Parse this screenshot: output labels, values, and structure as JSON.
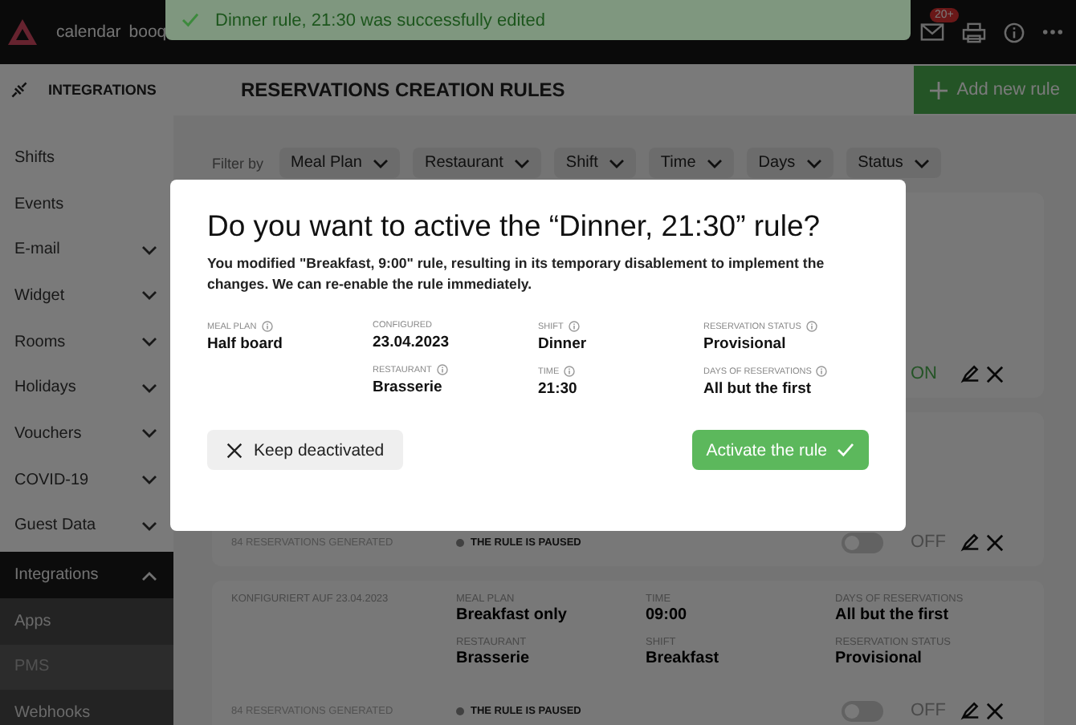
{
  "topbar": {
    "brand": [
      "calendar",
      "booq"
    ],
    "mail_badge": "20+"
  },
  "toast": {
    "message": "Dinner rule, 21:30 was successfully edited"
  },
  "section": {
    "title": "INTEGRATIONS"
  },
  "page": {
    "title": "RESERVATIONS CREATION RULES",
    "add_button": "Add new rule"
  },
  "sidebar": {
    "items": [
      {
        "label": "Shifts",
        "chevron": false,
        "expanded": false,
        "selected": false
      },
      {
        "label": "Events",
        "chevron": false,
        "expanded": false,
        "selected": false
      },
      {
        "label": "E-mail",
        "chevron": true,
        "expanded": false,
        "selected": false
      },
      {
        "label": "Widget",
        "chevron": true,
        "expanded": false,
        "selected": false
      },
      {
        "label": "Rooms",
        "chevron": true,
        "expanded": false,
        "selected": false
      },
      {
        "label": "Holidays",
        "chevron": true,
        "expanded": false,
        "selected": false
      },
      {
        "label": "Vouchers",
        "chevron": true,
        "expanded": false,
        "selected": false
      },
      {
        "label": "COVID-19",
        "chevron": true,
        "expanded": false,
        "selected": false
      },
      {
        "label": "Guest Data",
        "chevron": true,
        "expanded": false,
        "selected": false
      },
      {
        "label": "Integrations",
        "chevron": true,
        "expanded": true,
        "selected": false,
        "children": [
          {
            "label": "Apps",
            "selected": false
          },
          {
            "label": "PMS",
            "selected": true
          },
          {
            "label": "Webhooks",
            "selected": false
          }
        ]
      }
    ]
  },
  "filters": {
    "label": "Filter by",
    "items": [
      "Meal Plan",
      "Restaurant",
      "Shift",
      "Time",
      "Days",
      "Status"
    ]
  },
  "cards": [
    {
      "on": true,
      "on_label": "ON"
    },
    {
      "generated": "84 RESERVATIONS GENERATED",
      "status": "THE RULE IS PAUSED",
      "on": false,
      "on_label": "OFF"
    },
    {
      "configured": "KONFIGURIERT AUF 23.04.2023",
      "columns": [
        [
          {
            "label": "MEAL PLAN",
            "value": "Breakfast only"
          },
          {
            "label": "RESTAURANT",
            "value": "Brasserie"
          }
        ],
        [
          {
            "label": "TIME",
            "value": "09:00"
          },
          {
            "label": "SHIFT",
            "value": "Breakfast"
          }
        ],
        [
          {
            "label": "DAYS OF RESERVATIONS",
            "value": "All but the first"
          },
          {
            "label": "RESERVATION STATUS",
            "value": "Provisional"
          }
        ]
      ],
      "generated": "84 RESERVATIONS GENERATED",
      "status": "THE RULE IS PAUSED",
      "on": false,
      "on_label": "OFF"
    }
  ],
  "modal": {
    "title": "Do you want to active the “Dinner, 21:30” rule?",
    "description": "You modified \"Breakfast, 9:00\" rule, resulting in its temporary disablement to implement the changes. We can re-enable the rule immediately.",
    "columns": [
      [
        {
          "label": "MEAL PLAN",
          "value": "Half board",
          "info": true
        }
      ],
      [
        {
          "label": "CONFIGURED",
          "value": "23.04.2023",
          "info": false
        },
        {
          "label": "RESTAURANT",
          "value": "Brasserie",
          "info": true
        }
      ],
      [
        {
          "label": "SHIFT",
          "value": "Dinner",
          "info": true
        },
        {
          "label": "TIME",
          "value": "21:30",
          "info": true
        }
      ],
      [
        {
          "label": "RESERVATION STATUS",
          "value": "Provisional",
          "info": true
        },
        {
          "label": "DAYS OF RESERVATIONS",
          "value": "All but the first",
          "info": true
        }
      ]
    ],
    "cancel": "Keep deactivated",
    "confirm": "Activate the rule"
  }
}
